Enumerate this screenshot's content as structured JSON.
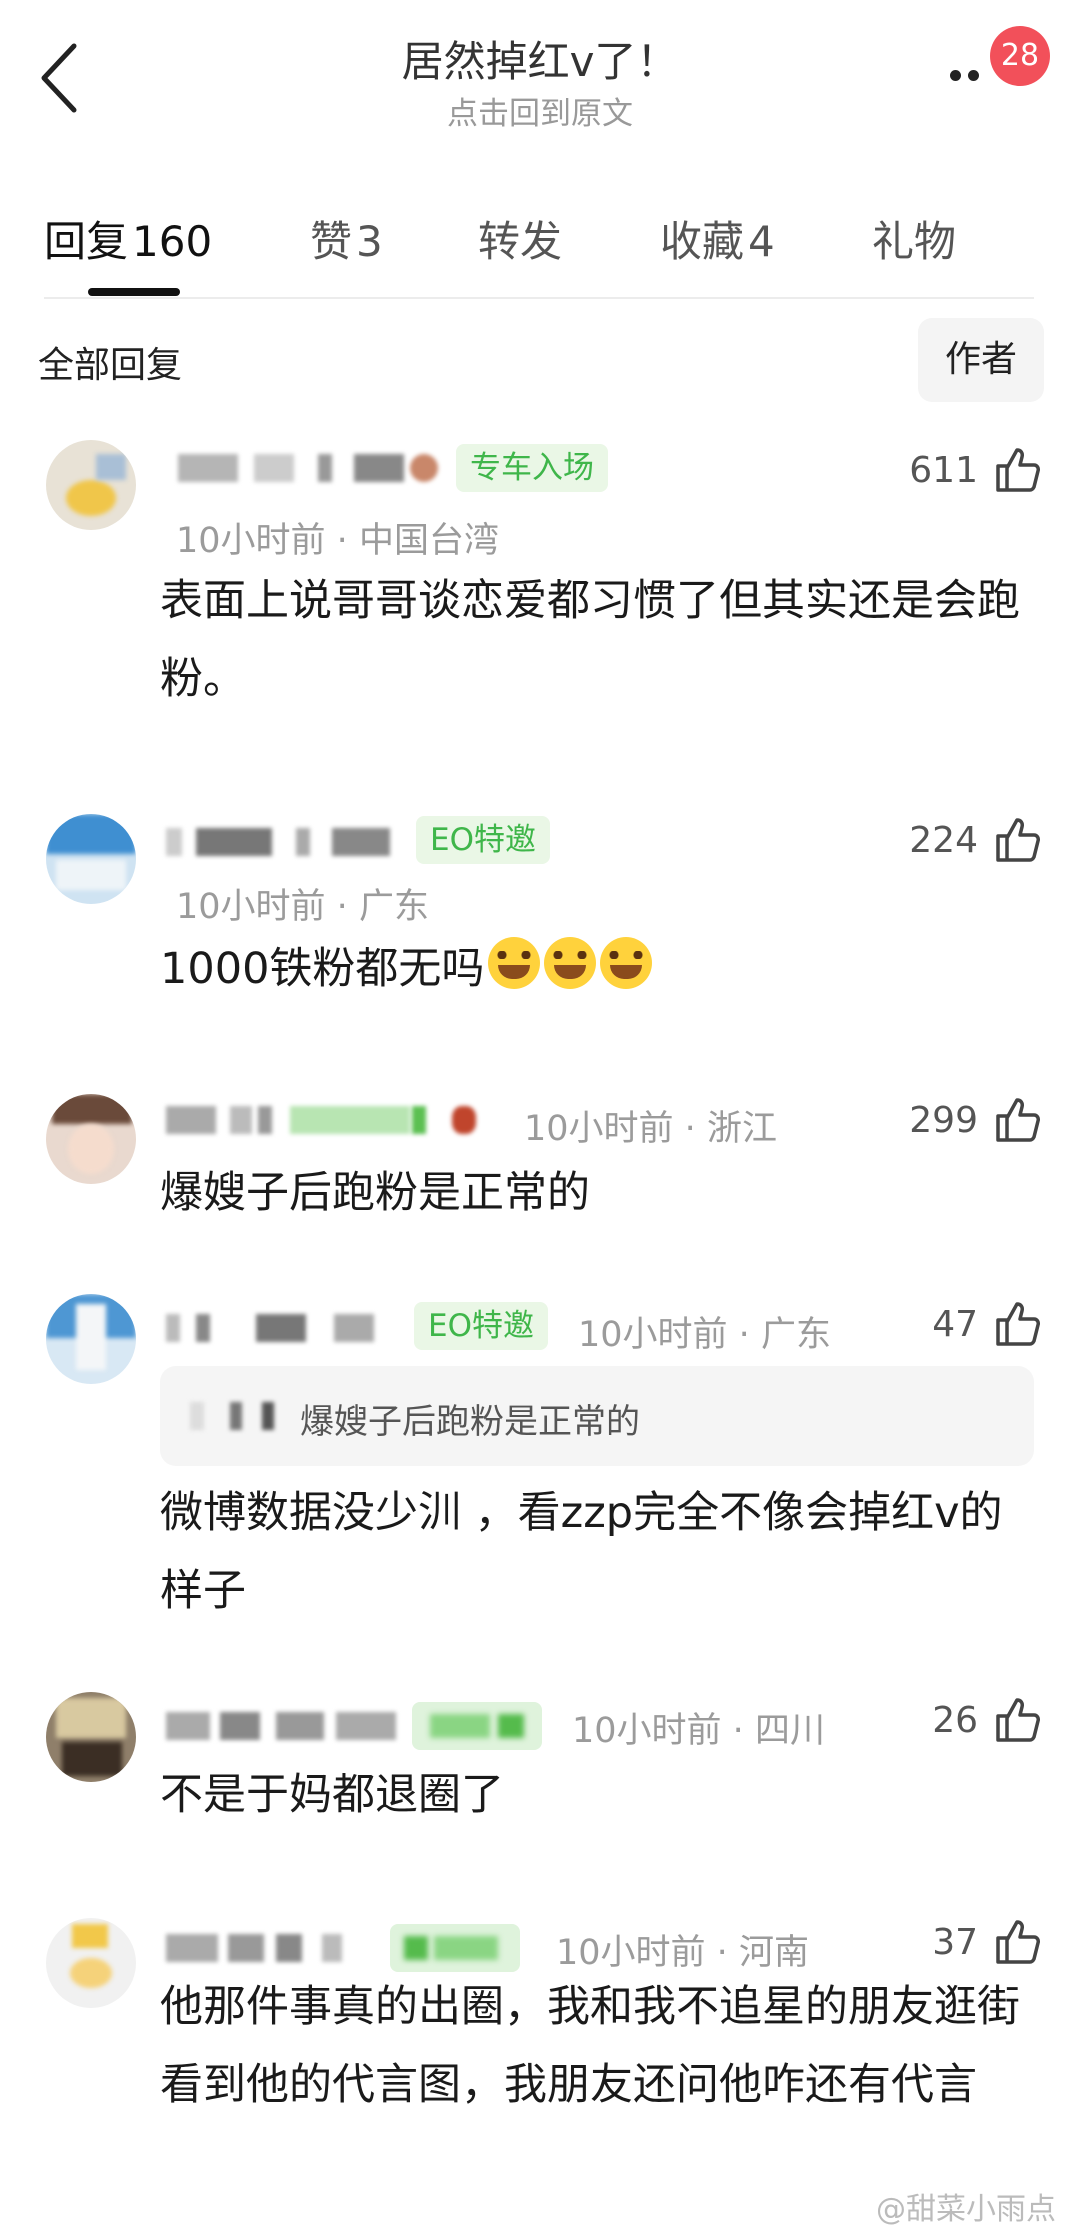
{
  "header": {
    "title": "居然掉红v了！",
    "subtitle": "点击回到原文",
    "badge": "28"
  },
  "tabs": [
    {
      "label": "回复",
      "count": "160"
    },
    {
      "label": "赞",
      "count": "3"
    },
    {
      "label": "转发",
      "count": ""
    },
    {
      "label": "收藏",
      "count": "4"
    },
    {
      "label": "礼物",
      "count": ""
    }
  ],
  "filter": {
    "label": "全部回复",
    "author_button": "作者"
  },
  "comments": [
    {
      "tag": "专车入场",
      "time": "10小时前",
      "location": "中国台湾",
      "likes": "611",
      "text": "表面上说哥哥谈恋爱都习惯了但其实还是会跑粉。"
    },
    {
      "tag": "EO特邀",
      "time": "10小时前",
      "location": "广东",
      "likes": "224",
      "text": "1000铁粉都无吗"
    },
    {
      "tag": "",
      "time": "10小时前",
      "location": "浙江",
      "likes": "299",
      "text": "爆嫂子后跑粉是正常的"
    },
    {
      "tag": "EO特邀",
      "time": "10小时前",
      "location": "广东",
      "likes": "47",
      "quote": "爆嫂子后跑粉是正常的",
      "text": "微博数据没少汌 ，看zzp完全不像会掉红v的样子"
    },
    {
      "tag": "",
      "time": "10小时前",
      "location": "四川",
      "likes": "26",
      "text": "不是于妈都退圈了"
    },
    {
      "tag": "",
      "time": "10小时前",
      "location": "河南",
      "likes": "37",
      "text": "他那件事真的出圈，我和我不追星的朋友逛街看到他的代言图，我朋友还问他咋还有代言"
    }
  ],
  "watermark": "@甜菜小雨点",
  "icons": {
    "back": "chevron-left-icon",
    "more": "more-dots-icon",
    "like": "thumbs-up-icon",
    "emoji": "laughing-tears-emoji"
  },
  "colors": {
    "badge": "#f2505a",
    "tag_green": "#3fb64a",
    "tag_bg": "#eaf7e6",
    "meta_gray": "#9b9b9b"
  }
}
